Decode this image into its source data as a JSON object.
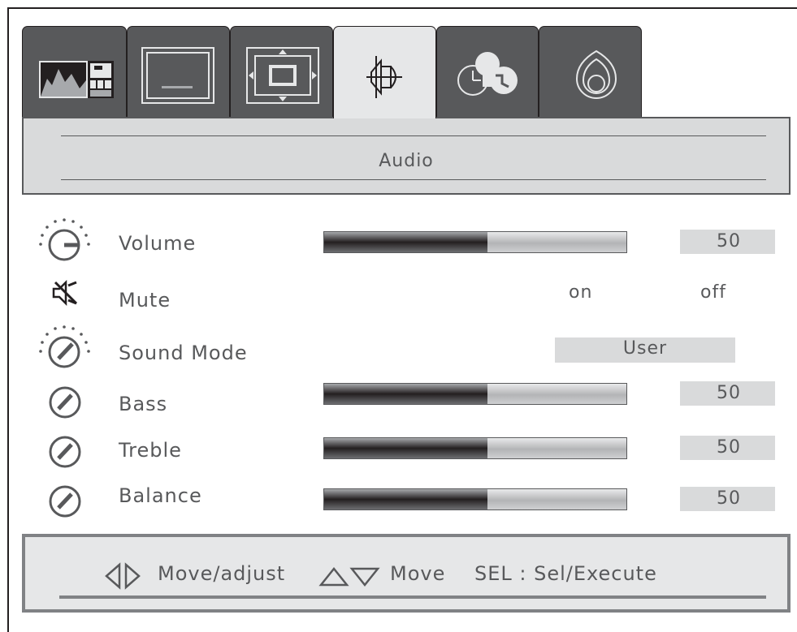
{
  "tabs": [
    {
      "name": "picture-mode-tab",
      "icon": "picture-mode-icon",
      "active": false
    },
    {
      "name": "screen-tab",
      "icon": "screen-icon",
      "active": false
    },
    {
      "name": "position-tab",
      "icon": "position-icon",
      "active": false
    },
    {
      "name": "audio-tab",
      "icon": "speaker-icon",
      "active": true
    },
    {
      "name": "timer-setup-tab",
      "icon": "timer-lightbulb-icon",
      "active": false
    },
    {
      "name": "advanced-tab",
      "icon": "advanced-icon",
      "active": false
    }
  ],
  "header": {
    "title": "Audio"
  },
  "items": {
    "volume": {
      "label": "Volume",
      "value": "50",
      "level": 0.54,
      "icon": "dial-icon"
    },
    "mute": {
      "label": "Mute",
      "on": "on",
      "off": "off",
      "icon": "mute-speaker-icon"
    },
    "sound_mode": {
      "label": "Sound Mode",
      "value": "User",
      "icon": "dial-icon"
    },
    "bass": {
      "label": "Bass",
      "value": "50",
      "level": 0.54,
      "icon": "knob-icon"
    },
    "treble": {
      "label": "Treble",
      "value": "50",
      "level": 0.54,
      "icon": "knob-icon"
    },
    "balance": {
      "label": "Balance",
      "value": "50",
      "level": 0.54,
      "icon": "knob-icon"
    }
  },
  "help": {
    "move_adjust": "Move/adjust",
    "move": "Move",
    "select": "SEL : Sel/Execute"
  },
  "colors": {
    "dark": "#58595b",
    "light": "#e6e7e8",
    "box": "#d9dadb",
    "outline": "#231f20"
  }
}
